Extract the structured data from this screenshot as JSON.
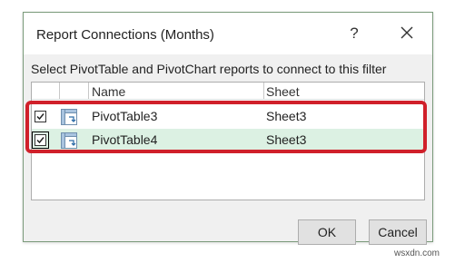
{
  "dialog": {
    "title": "Report Connections (Months)",
    "help_label": "?",
    "close_icon": "close-icon",
    "instruction": "Select PivotTable and PivotChart reports to connect to this filter"
  },
  "list": {
    "columns": [
      "Name",
      "Sheet"
    ],
    "rows": [
      {
        "checked": true,
        "name": "PivotTable3",
        "sheet": "Sheet3",
        "selected": false,
        "icon": "pivot-table-icon"
      },
      {
        "checked": true,
        "name": "PivotTable4",
        "sheet": "Sheet3",
        "selected": true,
        "icon": "pivot-table-icon"
      }
    ]
  },
  "buttons": {
    "ok_label": "OK",
    "cancel_label": "Cancel"
  },
  "annotation": {
    "highlight_color": "#d0202a"
  },
  "watermark": "wsxdn.com",
  "colors": {
    "selected_row": "#dcf1e3",
    "dialog_bg": "#f0f0f0"
  }
}
